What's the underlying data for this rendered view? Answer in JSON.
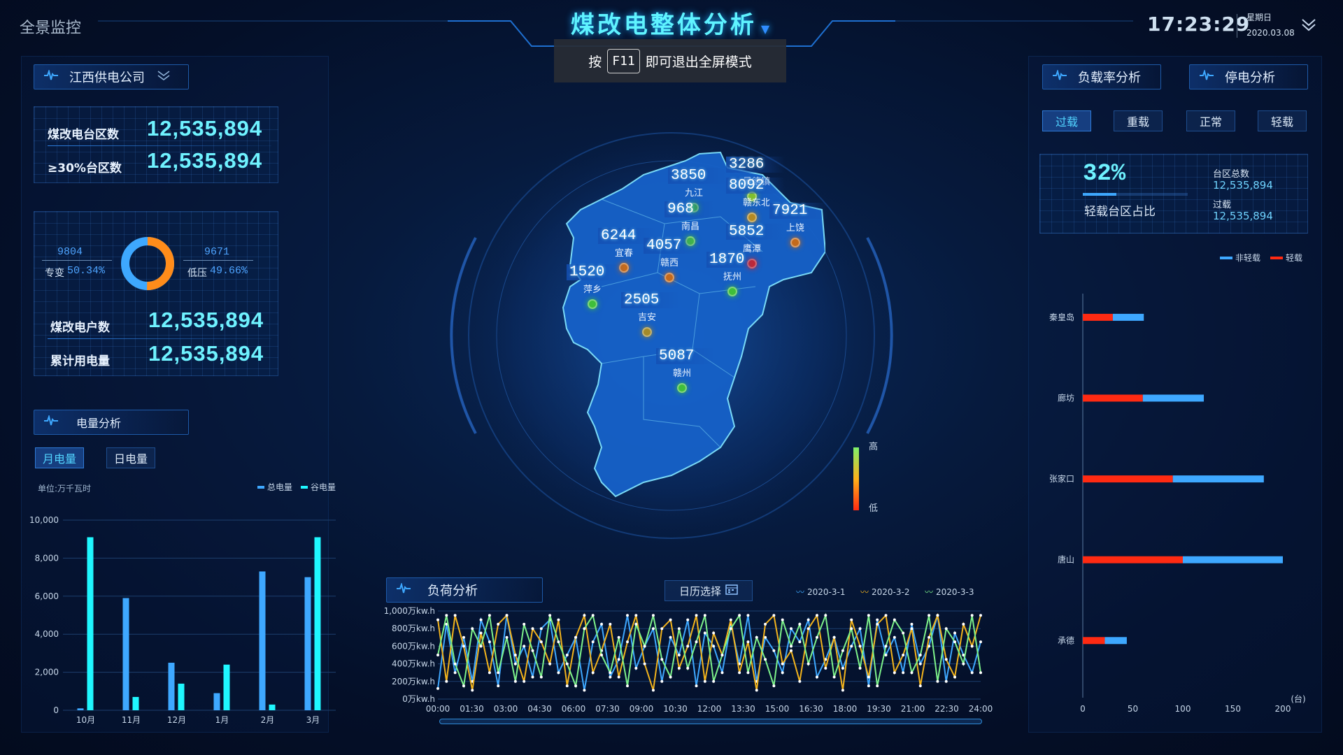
{
  "header": {
    "app_title": "全景监控",
    "main_title": "煤改电整体分析",
    "title_caret": "▼",
    "f11_prefix": "按",
    "f11_key": "F11",
    "f11_suffix": "即可退出全屏模式",
    "time": "17:23:29",
    "weekday": "星期日",
    "date": "2020.03.08",
    "expand_icon": "chevron-double-down-icon"
  },
  "company_selector": {
    "label": "江西供电公司",
    "icon": "pulse-icon"
  },
  "stats_top": [
    {
      "label": "煤改电台区数",
      "value": "12,535,894"
    },
    {
      "label": "≥30%台区数",
      "value": "12,535,894"
    }
  ],
  "donut": {
    "left_value": "9804",
    "left_label": "专变",
    "left_pct": "50.34%",
    "right_value": "9671",
    "right_label": "低压",
    "right_pct": "49.66%",
    "fraction": 0.5034,
    "colors": {
      "primary": "#ff8c1a",
      "secondary": "#3ea8ff"
    }
  },
  "stats_bottom": [
    {
      "label": "煤改电户数",
      "value": "12,535,894"
    },
    {
      "label": "累计用电量",
      "value": "12,535,894"
    }
  ],
  "energy_panel": {
    "title": "电量分析",
    "tabs": [
      "月电量",
      "日电量"
    ],
    "active_tab": 0,
    "unit": "单位:万千瓦时",
    "legend": [
      "总电量",
      "谷电量"
    ]
  },
  "chart_data": [
    {
      "type": "bar",
      "categories": [
        "10月",
        "11月",
        "12月",
        "1月",
        "2月",
        "3月"
      ],
      "series": [
        {
          "name": "总电量",
          "values": [
            100,
            5900,
            2500,
            900,
            7300,
            7000
          ],
          "color": "#3ea8ff"
        },
        {
          "name": "谷电量",
          "values": [
            9100,
            700,
            1400,
            2400,
            300,
            9100
          ],
          "color": "#1ff7ff"
        }
      ],
      "ylim": [
        0,
        10000
      ],
      "yticks": [
        "10,000",
        "8,000",
        "6,000",
        "4,000",
        "2,000",
        "0"
      ]
    },
    {
      "type": "line",
      "title": "负荷分析",
      "x": [
        "00:00",
        "01:30",
        "03:00",
        "04:30",
        "06:00",
        "07:30",
        "09:00",
        "10:30",
        "12:00",
        "13:30",
        "15:00",
        "16:30",
        "18:00",
        "19:30",
        "21:00",
        "22:30",
        "24:00"
      ],
      "yticks": [
        "1,000万kw.h",
        "800万kw.h",
        "600万kw.h",
        "400万kw.h",
        "200万kw.h",
        "0万kw.h"
      ],
      "ylim": [
        0,
        1000
      ],
      "series": [
        {
          "name": "2020-3-1",
          "color": "#3ea8ff",
          "values": [
            120,
            850,
            300,
            700,
            200,
            900,
            650,
            150,
            950,
            400,
            600,
            250,
            800,
            900,
            300,
            500,
            700,
            100,
            650,
            850,
            250,
            450,
            950,
            350,
            600,
            800,
            200,
            700,
            500,
            900,
            150,
            750,
            600,
            300,
            850,
            400,
            950,
            200,
            700,
            550,
            300,
            800,
            650,
            900,
            250,
            450,
            700,
            350,
            600,
            800,
            150,
            900,
            500,
            700,
            300,
            850,
            400,
            600,
            950,
            200,
            750,
            500,
            300,
            650
          ]
        },
        {
          "name": "2020-3-2",
          "color": "#f2b31c",
          "values": [
            900,
            200,
            950,
            600,
            100,
            750,
            300,
            850,
            950,
            500,
            200,
            800,
            650,
            400,
            900,
            150,
            700,
            950,
            300,
            550,
            850,
            250,
            650,
            950,
            400,
            100,
            800,
            900,
            350,
            600,
            950,
            200,
            750,
            500,
            900,
            300,
            650,
            100,
            850,
            950,
            400,
            550,
            200,
            800,
            950,
            350,
            700,
            100,
            900,
            600,
            250,
            850,
            950,
            300,
            500,
            800,
            150,
            700,
            950,
            450,
            250,
            850,
            600,
            950
          ]
        },
        {
          "name": "2020-3-3",
          "color": "#7df28a",
          "values": [
            500,
            950,
            400,
            150,
            800,
            600,
            950,
            300,
            700,
            200,
            850,
            550,
            250,
            950,
            650,
            400,
            150,
            800,
            950,
            500,
            300,
            700,
            150,
            850,
            600,
            950,
            450,
            250,
            800,
            350,
            650,
            950,
            200,
            500,
            800,
            950,
            300,
            700,
            450,
            150,
            900,
            600,
            850,
            400,
            700,
            950,
            250,
            550,
            800,
            350,
            950,
            150,
            600,
            900,
            750,
            300,
            500,
            950,
            200,
            800,
            650,
            400,
            950,
            300
          ]
        }
      ]
    },
    {
      "type": "bar",
      "orientation": "horizontal",
      "categories": [
        "秦皇岛",
        "廊坊",
        "张家口",
        "唐山",
        "承德"
      ],
      "series": [
        {
          "name": "轻载",
          "color": "#ff2a12",
          "values": [
            30,
            60,
            90,
            100,
            22
          ]
        },
        {
          "name": "非轻载",
          "color": "#3ea8ff",
          "values": [
            31,
            61,
            91,
            100,
            22
          ]
        }
      ],
      "xlim": [
        0,
        200
      ],
      "xticks": [
        "0",
        "50",
        "100",
        "150",
        "200"
      ],
      "xunit": "(台)"
    }
  ],
  "load_panel": {
    "title": "负荷分析",
    "calendar_label": "日历选择",
    "legend": [
      "2020-3-1",
      "2020-3-2",
      "2020-3-3"
    ]
  },
  "right_tabs": [
    {
      "label": "负载率分析"
    },
    {
      "label": "停电分析"
    }
  ],
  "load_filters": [
    "过载",
    "重载",
    "正常",
    "轻载"
  ],
  "load_active": 0,
  "ratio_box": {
    "percent": "32%",
    "fill": 0.32,
    "label": "轻载台区占比",
    "total_label": "台区总数",
    "total_value": "12,535,894",
    "over_label": "过载",
    "over_value": "12,535,894"
  },
  "right_legend": [
    "非轻载",
    "轻载"
  ],
  "map": {
    "regions": [
      {
        "name": "景德镇",
        "value": "3286",
        "dot": "#7fbf2e"
      },
      {
        "name": "九江",
        "value": "3850",
        "dot": "#3fbf3a"
      },
      {
        "name": "赣东北",
        "value": "8092",
        "dot": "#b58a22"
      },
      {
        "name": "南昌",
        "value": "968",
        "dot": "#48c43a"
      },
      {
        "name": "上饶",
        "value": "7921",
        "dot": "#c46a1c"
      },
      {
        "name": "宜春",
        "value": "6244",
        "dot": "#c46a1c"
      },
      {
        "name": "鹰潭",
        "value": "5852",
        "dot": "#e02020"
      },
      {
        "name": "赣西",
        "value": "4057",
        "dot": "#c46a1c"
      },
      {
        "name": "抚州",
        "value": "1870",
        "dot": "#3fbf3a"
      },
      {
        "name": "萍乡",
        "value": "1520",
        "dot": "#3fbf3a"
      },
      {
        "name": "吉安",
        "value": "2505",
        "dot": "#a38a2a"
      },
      {
        "name": "赣州",
        "value": "5087",
        "dot": "#3fbf3a"
      }
    ],
    "legend_high": "高",
    "legend_low": "低"
  }
}
